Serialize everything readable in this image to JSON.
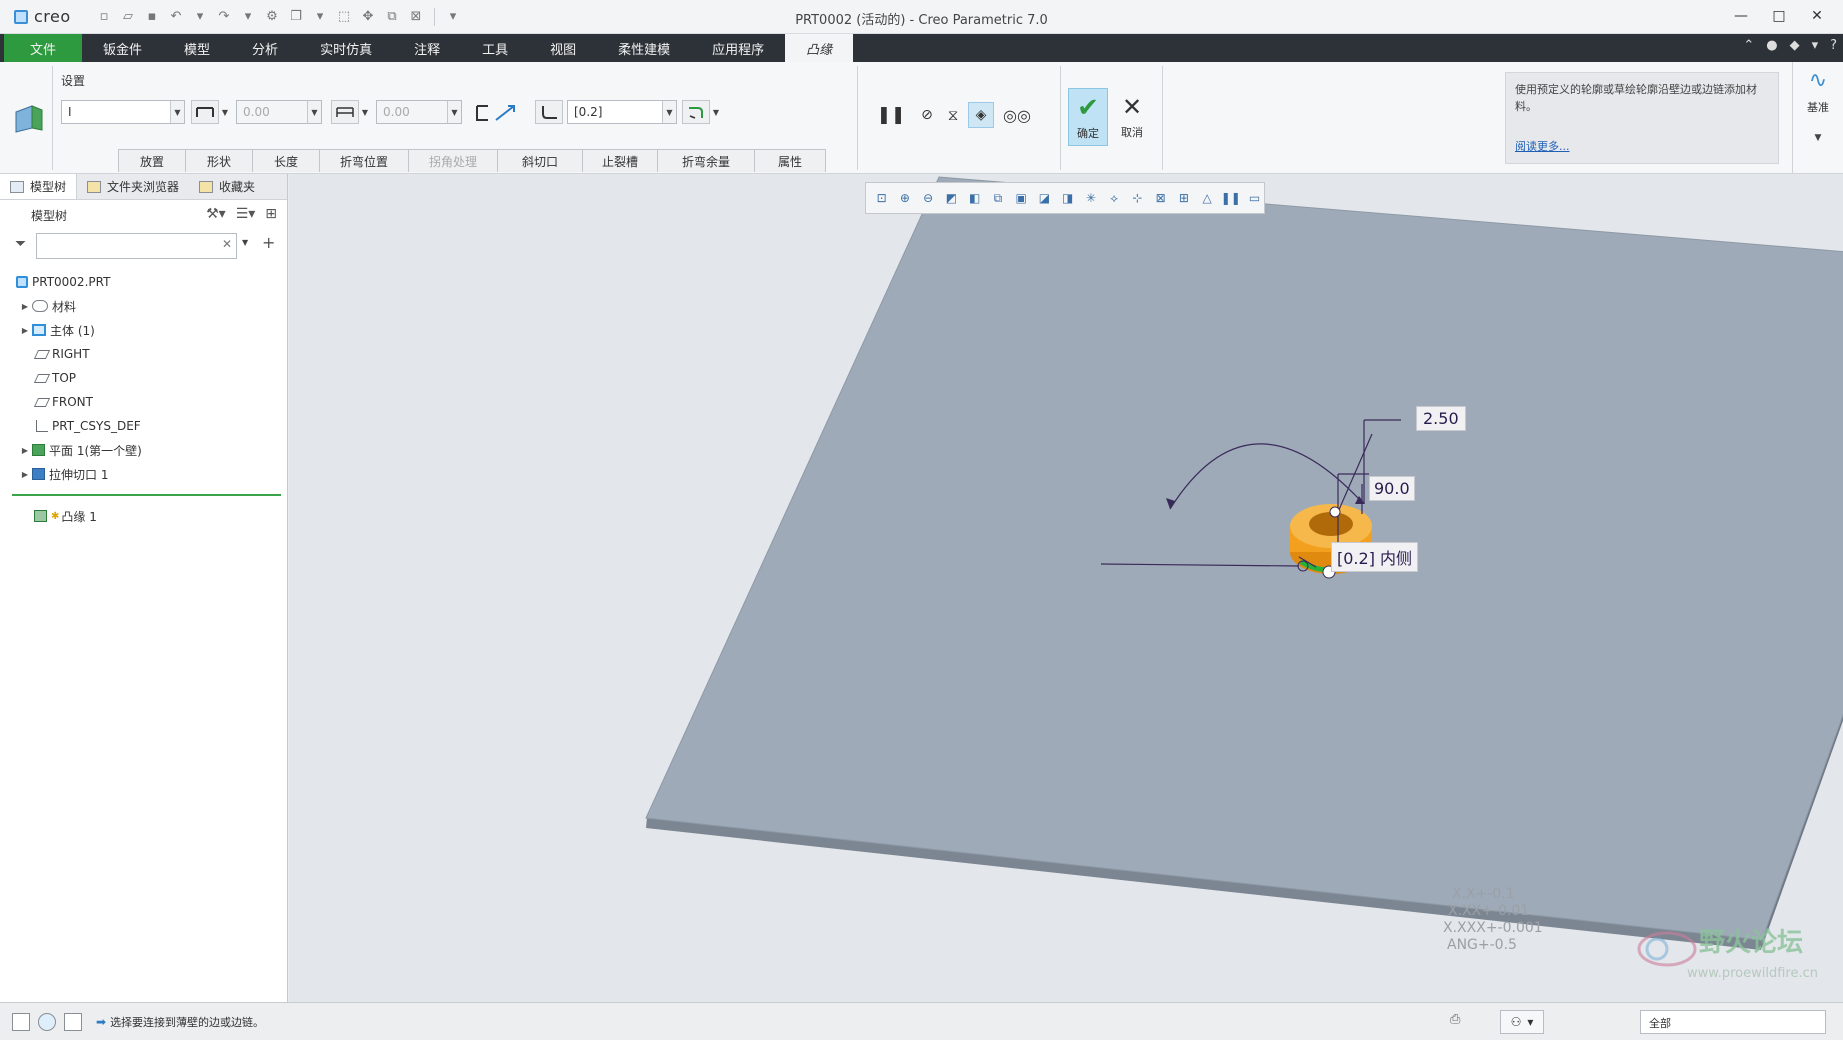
{
  "window": {
    "app_name": "creo",
    "title": "PRT0002 (活动的) - Creo Parametric 7.0"
  },
  "menu": {
    "items": [
      "文件",
      "钣金件",
      "模型",
      "分析",
      "实时仿真",
      "注释",
      "工具",
      "视图",
      "柔性建模",
      "应用程序"
    ],
    "active_tab": "凸缘"
  },
  "ribbon": {
    "settings_label": "设置",
    "shape_select": "I",
    "length1_value": "0.00",
    "length2_value": "0.00",
    "bend_radius_value": "[0.2]",
    "tabs": [
      "放置",
      "形状",
      "长度",
      "折弯位置",
      "拐角处理",
      "斜切口",
      "止裂槽",
      "折弯余量",
      "属性"
    ],
    "ok_label": "确定",
    "cancel_label": "取消",
    "help_text": "使用预定义的轮廓或草绘轮廓沿壁边或边链添加材料。",
    "help_link": "阅读更多...",
    "datum_label": "基准"
  },
  "left_panel": {
    "tabs": [
      "模型树",
      "文件夹浏览器",
      "收藏夹"
    ],
    "header": "模型树",
    "search_placeholder": "",
    "tree": [
      {
        "label": "PRT0002.PRT",
        "icon": "part-icon",
        "expandable": false
      },
      {
        "label": "材料",
        "icon": "material-icon",
        "expandable": true
      },
      {
        "label": "主体 (1)",
        "icon": "body-icon",
        "expandable": true
      },
      {
        "label": "RIGHT",
        "icon": "datum-plane-icon",
        "expandable": false
      },
      {
        "label": "TOP",
        "icon": "datum-plane-icon",
        "expandable": false
      },
      {
        "label": "FRONT",
        "icon": "datum-plane-icon",
        "expandable": false
      },
      {
        "label": "PRT_CSYS_DEF",
        "icon": "csys-icon",
        "expandable": false
      },
      {
        "label": "平面 1(第一个壁)",
        "icon": "planar-wall-icon",
        "expandable": true
      },
      {
        "label": "拉伸切口 1",
        "icon": "extrude-cut-icon",
        "expandable": true
      }
    ],
    "current_feature": "凸缘 1"
  },
  "viewport": {
    "dims": {
      "height": "2.50",
      "angle": "90.0",
      "radius": "[0.2] 内侧"
    },
    "tolerances": [
      "X.X+-0.1",
      "X.XX+-0.01",
      "X.XXX+-0.001",
      "ANG+-0.5"
    ],
    "watermark": "野火论坛",
    "watermark_url": "www.proewildfire.cn",
    "colors": {
      "plate_top": "#9faab8",
      "plate_side": "#7c8592",
      "flange": "#f2a01d",
      "selection": "#27b33a"
    }
  },
  "status": {
    "message": "选择要连接到薄壁的边或边链。",
    "filter_value": "全部"
  }
}
